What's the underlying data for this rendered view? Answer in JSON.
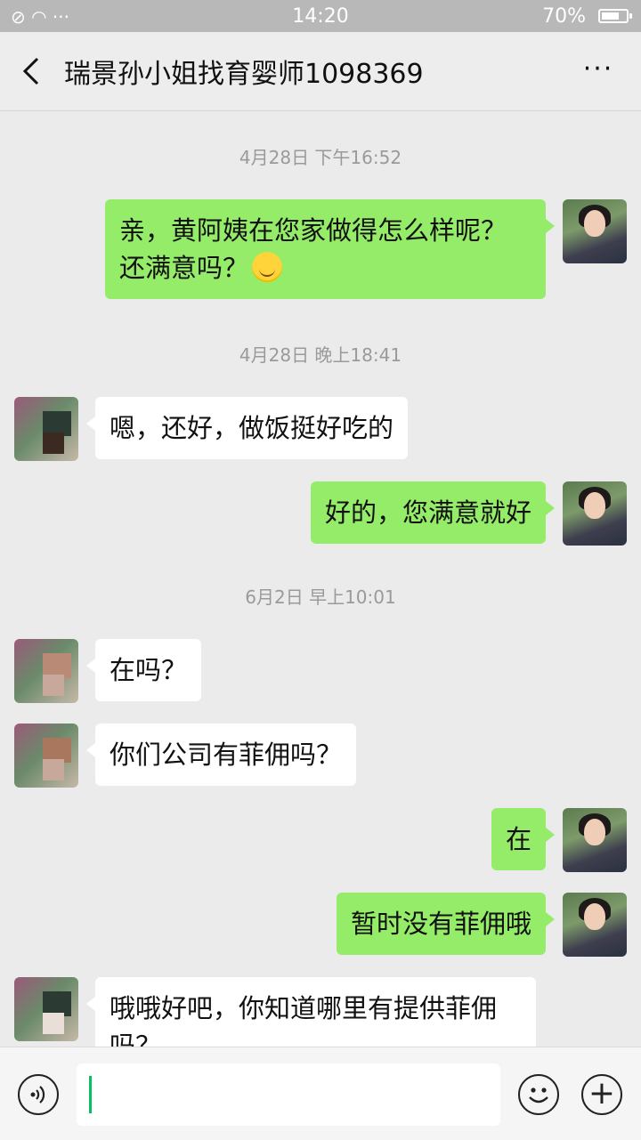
{
  "status_bar": {
    "left_icons": "⊘ ◠ ···",
    "time": "14:20",
    "battery": "70%",
    "battery_level": 0.7
  },
  "header": {
    "title": "瑞景孙小姐找育婴师1098369"
  },
  "messages": [
    {
      "kind": "time",
      "text": "4月28日 下午16:52"
    },
    {
      "kind": "me",
      "text": "亲，黄阿姨在您家做得怎么样呢？还满意吗？",
      "emoji": "smile-emoji"
    },
    {
      "kind": "time",
      "text": "4月28日 晚上18:41"
    },
    {
      "kind": "them",
      "text": "嗯，还好，做饭挺好吃的"
    },
    {
      "kind": "me",
      "text": "好的，您满意就好"
    },
    {
      "kind": "time",
      "text": "6月2日 早上10:01"
    },
    {
      "kind": "them",
      "text": "在吗？"
    },
    {
      "kind": "them",
      "text": "你们公司有菲佣吗？"
    },
    {
      "kind": "me",
      "text": "在"
    },
    {
      "kind": "me",
      "text": "暂时没有菲佣哦"
    },
    {
      "kind": "them",
      "text": "哦哦好吧，你知道哪里有提供菲佣吗？"
    }
  ],
  "input_bar": {
    "value": ""
  },
  "colors": {
    "my_bubble": "#95ec69",
    "their_bubble": "#ffffff",
    "background": "#ebebeb",
    "cursor": "#07c160"
  }
}
